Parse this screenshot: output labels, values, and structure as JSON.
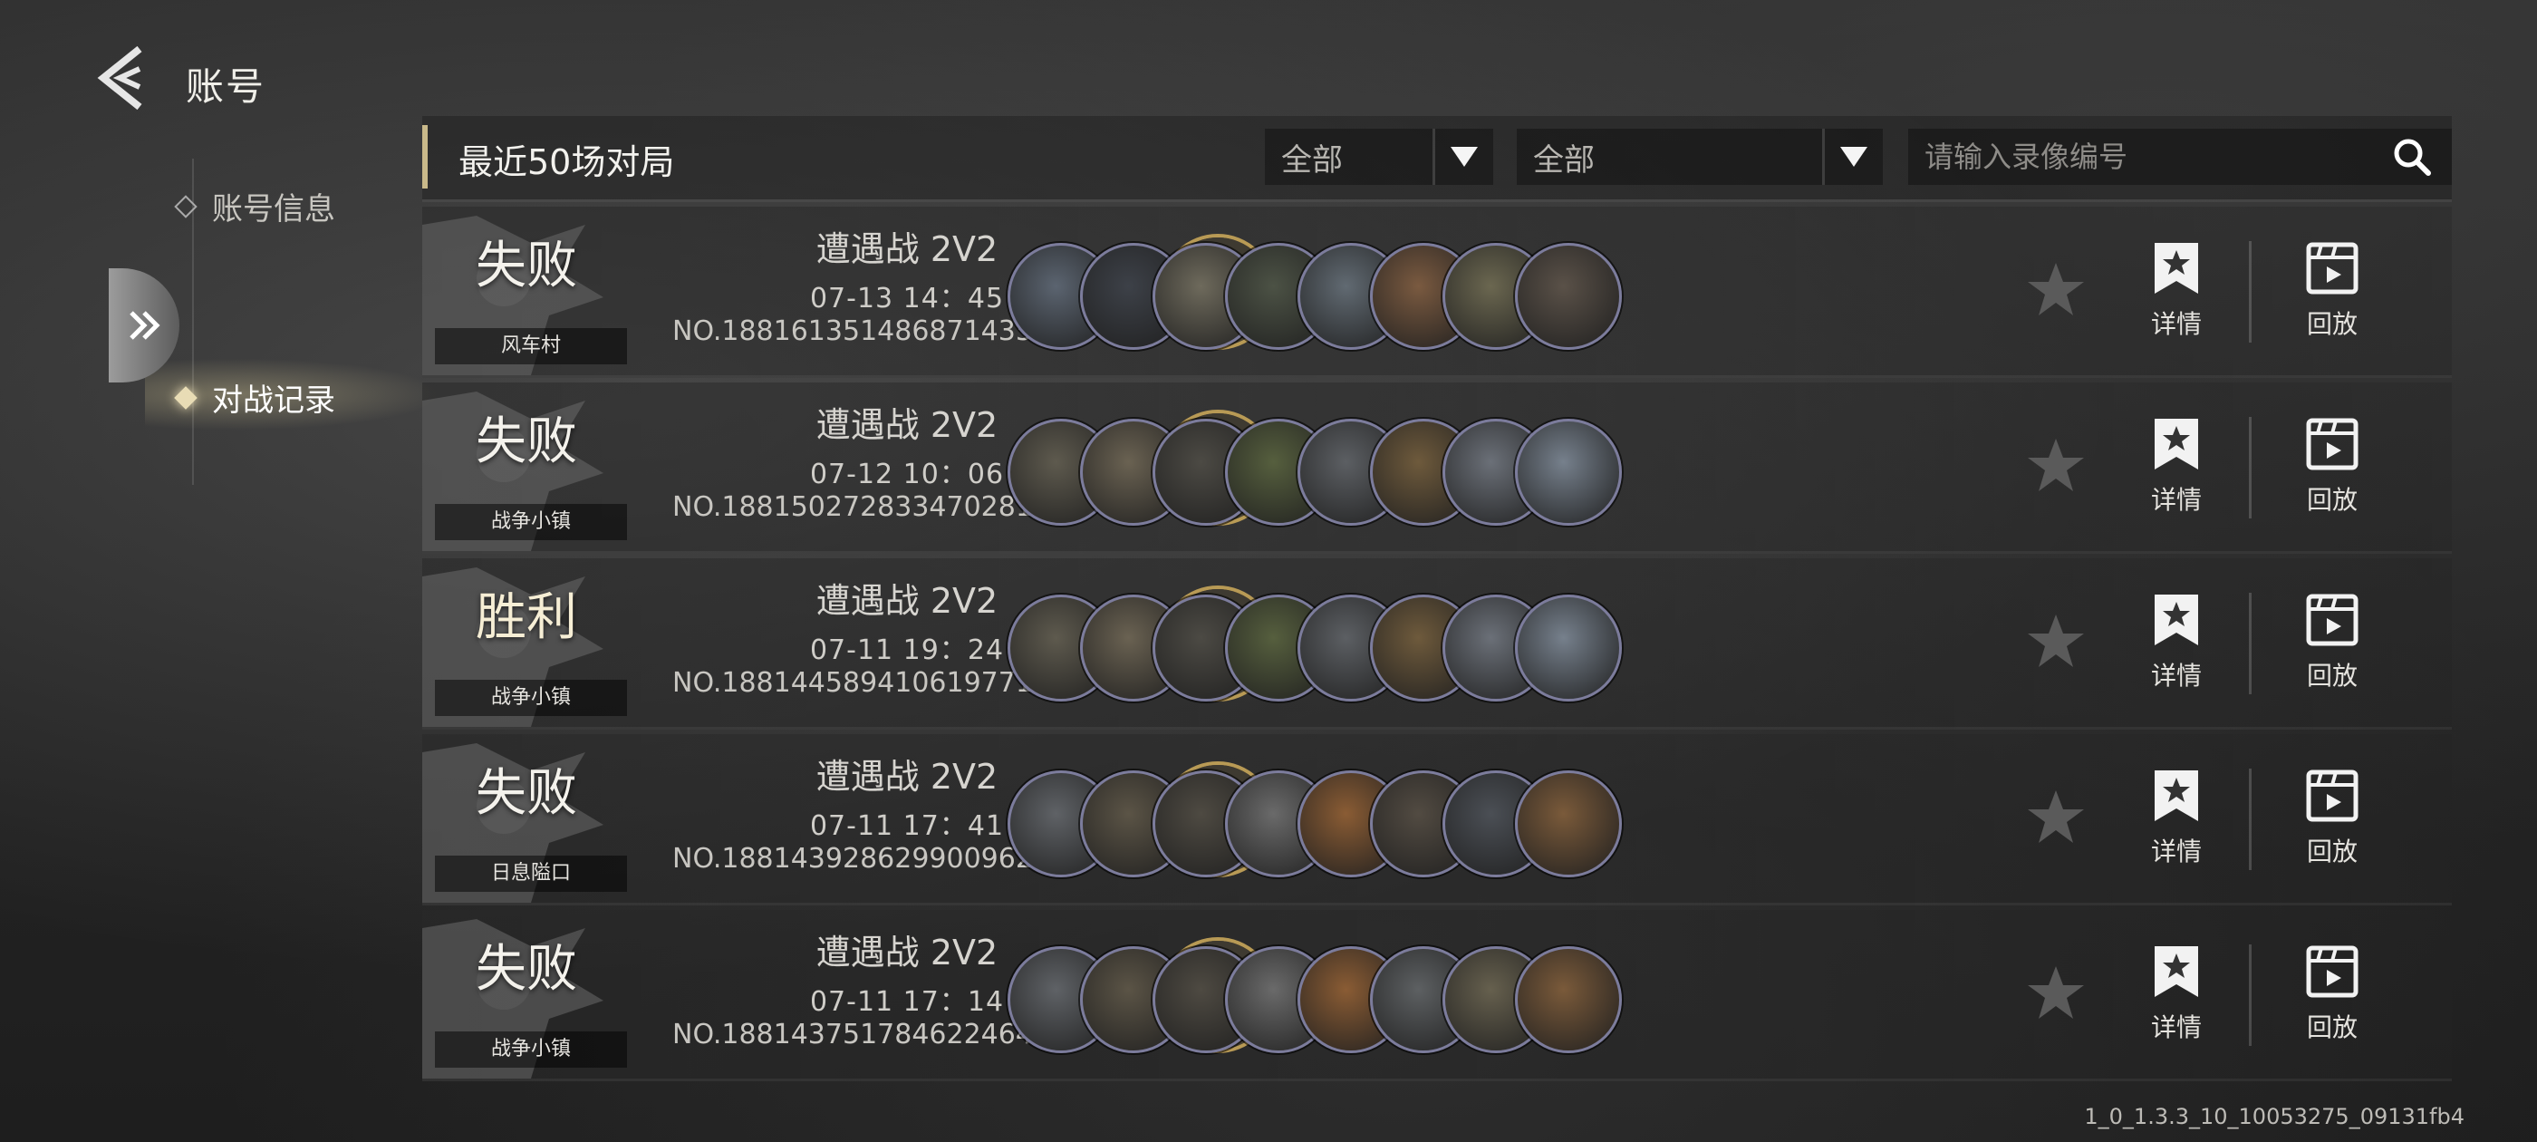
{
  "header": {
    "title": "账号"
  },
  "nav": {
    "items": [
      {
        "label": "账号信息"
      },
      {
        "label": "对战记录"
      }
    ]
  },
  "toolbar": {
    "title": "最近50场对局",
    "filter1": "全部",
    "filter2": "全部",
    "search_placeholder": "请输入录像编号"
  },
  "rows": [
    {
      "result": "失败",
      "map": "风车村",
      "mode": "遭遇战 2V2",
      "time": "07-13  14：45",
      "number": "NO.1881613514868714355",
      "detail_label": "详情",
      "replay_label": "回放"
    },
    {
      "result": "失败",
      "map": "战争小镇",
      "mode": "遭遇战 2V2",
      "time": "07-12  10：06",
      "number": "NO.1881502728334702811",
      "detail_label": "详情",
      "replay_label": "回放"
    },
    {
      "result": "胜利",
      "map": "战争小镇",
      "mode": "遭遇战 2V2",
      "time": "07-11  19：24",
      "number": "NO.1881445894106197710",
      "detail_label": "详情",
      "replay_label": "回放"
    },
    {
      "result": "失败",
      "map": "日息隘口",
      "mode": "遭遇战 2V2",
      "time": "07-11  17：41",
      "number": "NO.1881439286299009626",
      "detail_label": "详情",
      "replay_label": "回放"
    },
    {
      "result": "失败",
      "map": "战争小镇",
      "mode": "遭遇战 2V2",
      "time": "07-11  17：14",
      "number": "NO.1881437517846224640",
      "detail_label": "详情",
      "replay_label": "回放"
    }
  ],
  "version": "1_0_1.3.3_10_10053275_09131fb4",
  "colors": {
    "accent": "#c9b98a",
    "avatar_border": "#b89a55",
    "unit_border": "#7c7c9c"
  }
}
